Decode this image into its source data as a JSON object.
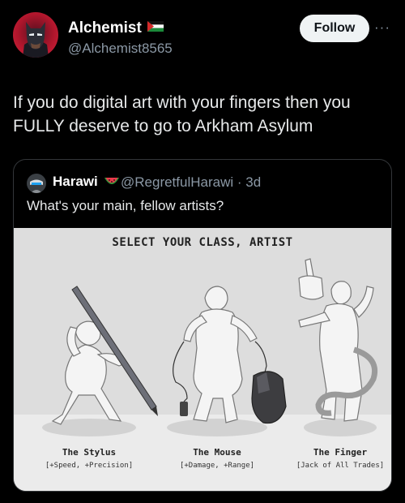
{
  "author": {
    "name": "Alchemist",
    "handle": "@Alchemist8565"
  },
  "follow_label": "Follow",
  "more_label": "···",
  "tweet_text": "If you do digital art with your fingers then you FULLY deserve to go to Arkham Asylum",
  "quoted": {
    "name": "Harawi",
    "name_emoji": "watermelon",
    "handle_time": "@RegretfulHarawi · 3d",
    "text": "What's your main, fellow artists?"
  },
  "image": {
    "title": "SELECT YOUR CLASS, ARTIST",
    "classes": [
      {
        "name": "The Stylus",
        "stats": "[+Speed, +Precision]"
      },
      {
        "name": "The Mouse",
        "stats": "[+Damage, +Range]"
      },
      {
        "name": "The Finger",
        "stats": "[Jack of All Trades]"
      }
    ]
  },
  "icons": {
    "author_badge": "palestine-flag-icon",
    "quoted_badge": "watermelon-icon",
    "more": "more-dots-icon"
  }
}
